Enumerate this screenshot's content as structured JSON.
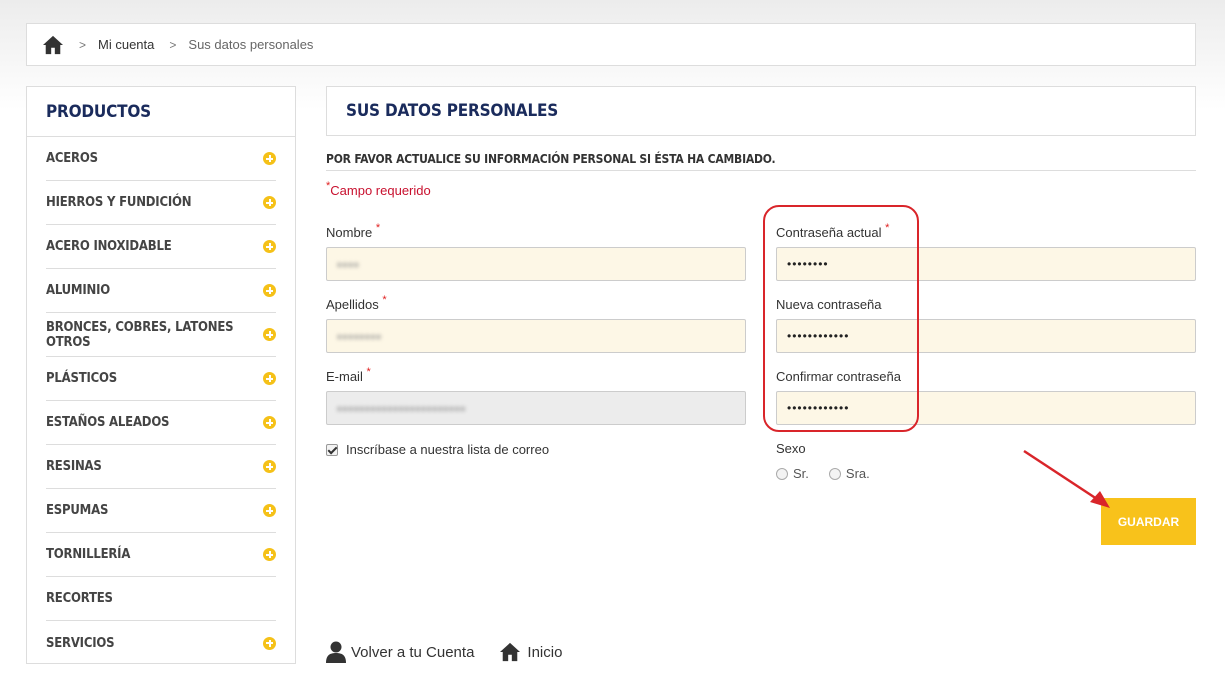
{
  "breadcrumb": {
    "home_icon": "home-icon",
    "separator": ">",
    "items": [
      "Mi cuenta",
      "Sus datos personales"
    ]
  },
  "sidebar": {
    "title": "PRODUCTOS",
    "items": [
      {
        "label": "ACEROS",
        "expand": true
      },
      {
        "label": "HIERROS Y FUNDICIÓN",
        "expand": true
      },
      {
        "label": "ACERO INOXIDABLE",
        "expand": true
      },
      {
        "label": "ALUMINIO",
        "expand": true
      },
      {
        "label": "BRONCES, COBRES, LATONES OTROS",
        "expand": true
      },
      {
        "label": "PLÁSTICOS",
        "expand": true
      },
      {
        "label": "ESTAÑOS ALEADOS",
        "expand": true
      },
      {
        "label": "RESINAS",
        "expand": true
      },
      {
        "label": "ESPUMAS",
        "expand": true
      },
      {
        "label": "TORNILLERÍA",
        "expand": true
      },
      {
        "label": "RECORTES",
        "expand": false
      },
      {
        "label": "SERVICIOS",
        "expand": true
      }
    ]
  },
  "main": {
    "title": "SUS DATOS PERSONALES",
    "subtitle": "POR FAVOR ACTUALICE SU INFORMACIÓN PERSONAL SI ÉSTA HA CAMBIADO.",
    "required_mark": "*",
    "required_note": "Campo requerido",
    "form": {
      "nombre": {
        "label": "Nombre",
        "value": "▪▪▪▪"
      },
      "apellidos": {
        "label": "Apellidos",
        "value": "▪▪▪▪▪▪▪▪"
      },
      "email": {
        "label": "E-mail",
        "value": "▪▪▪▪▪▪▪▪▪▪▪▪▪▪▪▪▪▪▪▪▪▪▪"
      },
      "current_password": {
        "label": "Contraseña actual",
        "value": "••••••••"
      },
      "new_password": {
        "label": "Nueva contraseña",
        "value": "••••••••••••"
      },
      "confirm_password": {
        "label": "Confirmar contraseña",
        "value": "••••••••••••"
      },
      "newsletter": {
        "label": "Inscríbase a nuestra lista de correo",
        "checked": true
      },
      "sexo": {
        "label": "Sexo",
        "options": [
          "Sr.",
          "Sra."
        ],
        "selected": null
      }
    },
    "save_label": "GUARDAR"
  },
  "footer": {
    "back_account": "Volver a tu Cuenta",
    "home": "Inicio"
  },
  "colors": {
    "accent": "#f8c21b",
    "title": "#1a2b5c",
    "required": "#c8102e",
    "annotation": "#d9252a",
    "field_bg": "#fdf7e6"
  }
}
